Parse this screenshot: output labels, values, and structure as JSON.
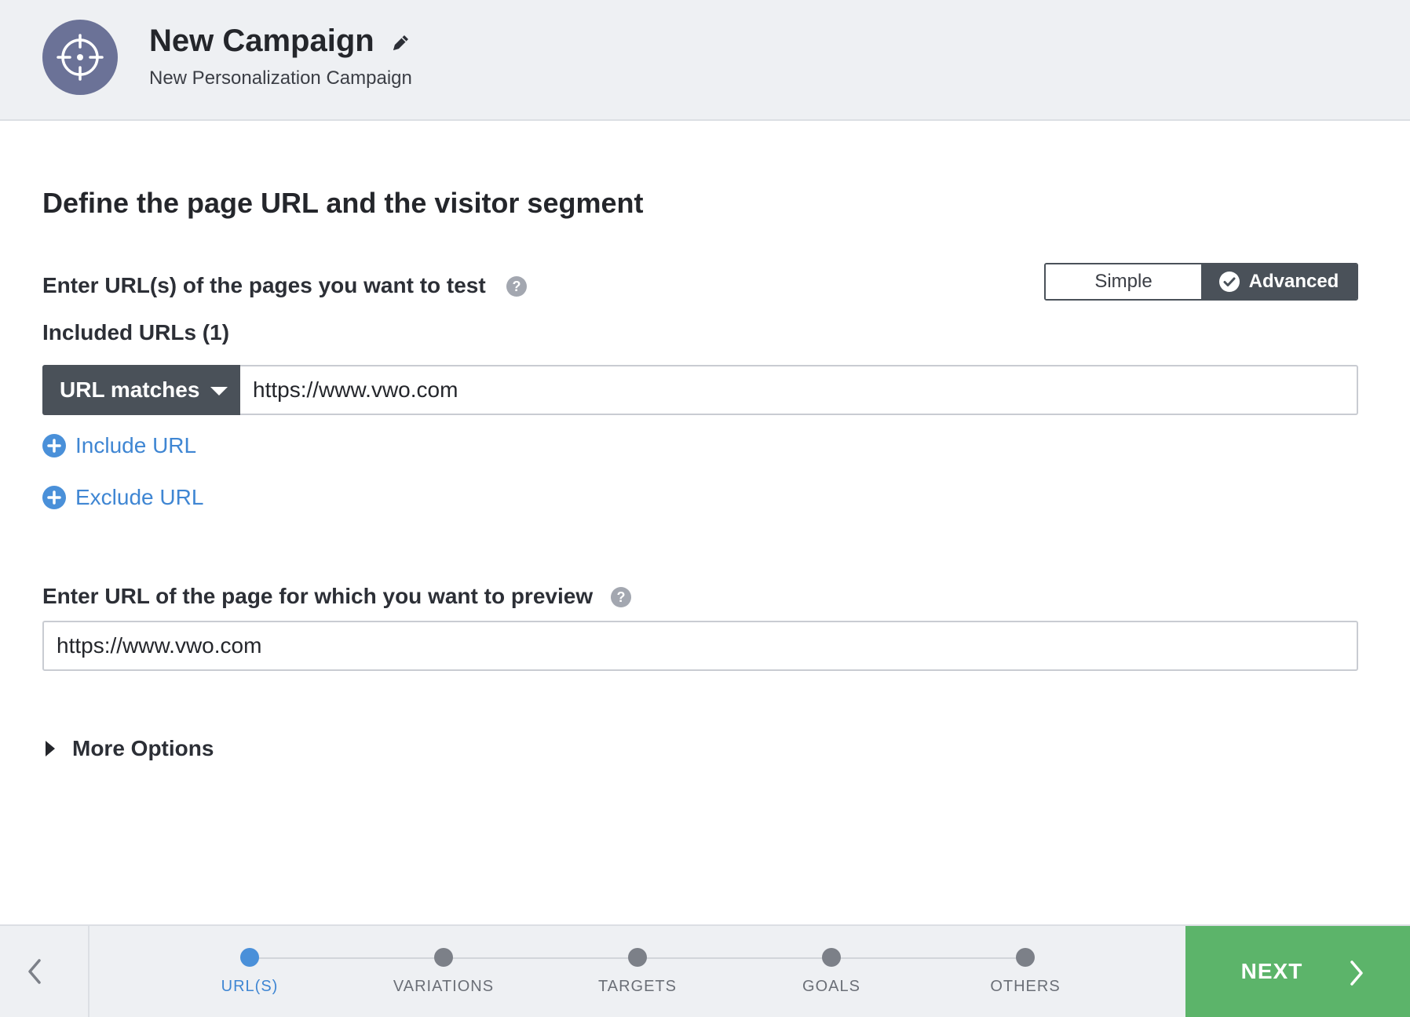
{
  "header": {
    "title": "New Campaign",
    "subtitle": "New Personalization Campaign",
    "logo_icon": "crosshair-icon",
    "edit_icon": "pencil-icon"
  },
  "main": {
    "heading": "Define the page URL and the visitor segment",
    "urls_label": "Enter URL(s) of the pages you want to test",
    "help_icon": "?",
    "mode_toggle": {
      "options": [
        "Simple",
        "Advanced"
      ],
      "selected": "Advanced"
    },
    "included_label": "Included URLs (1)",
    "match_type": "URL matches",
    "included_url": "https://www.vwo.com",
    "include_link": "Include URL",
    "exclude_link": "Exclude URL",
    "preview_label": "Enter URL of the page for which you want to preview",
    "preview_url": "https://www.vwo.com",
    "more_options": "More Options"
  },
  "footer": {
    "steps": [
      {
        "label": "URL(S)",
        "active": true
      },
      {
        "label": "VARIATIONS",
        "active": false
      },
      {
        "label": "TARGETS",
        "active": false
      },
      {
        "label": "GOALS",
        "active": false
      },
      {
        "label": "OTHERS",
        "active": false
      }
    ],
    "next_label": "NEXT"
  },
  "colors": {
    "header_bg": "#eef0f3",
    "logo_bg": "#6b7297",
    "dark": "#4a5159",
    "link_blue": "#3f86d3",
    "active_step": "#4a90d9",
    "next_green": "#5cb46a"
  }
}
